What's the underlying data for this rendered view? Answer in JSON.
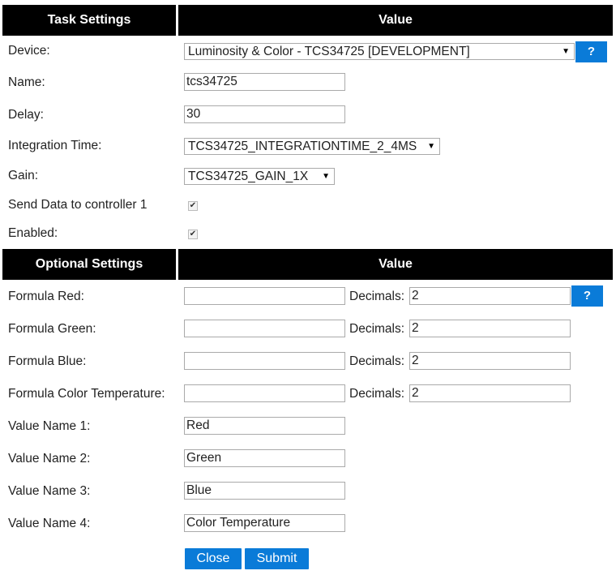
{
  "task_table": {
    "header_left": "Task Settings",
    "header_right": "Value",
    "rows": [
      {
        "label": "Device:",
        "value": "Luminosity & Color - TCS34725 [DEVELOPMENT]"
      },
      {
        "label": "Name:",
        "value": "tcs34725"
      },
      {
        "label": "Delay:",
        "value": "30"
      },
      {
        "label": "Integration Time:",
        "value": "TCS34725_INTEGRATIONTIME_2_4MS"
      },
      {
        "label": "Gain:",
        "value": "TCS34725_GAIN_1X"
      },
      {
        "label": "Send Data to controller 1",
        "checked": true
      },
      {
        "label": "Enabled:",
        "checked": true
      }
    ],
    "help_label": "?"
  },
  "optional_table": {
    "header_left": "Optional Settings",
    "header_right": "Value",
    "decimals_label": "Decimals:",
    "formulas": [
      {
        "label": "Formula Red:",
        "formula": "",
        "decimals": "2"
      },
      {
        "label": "Formula Green:",
        "formula": "",
        "decimals": "2"
      },
      {
        "label": "Formula Blue:",
        "formula": "",
        "decimals": "2"
      },
      {
        "label": "Formula Color Temperature:",
        "formula": "",
        "decimals": "2"
      }
    ],
    "value_names": [
      {
        "label": "Value Name 1:",
        "value": "Red"
      },
      {
        "label": "Value Name 2:",
        "value": "Green"
      },
      {
        "label": "Value Name 3:",
        "value": "Blue"
      },
      {
        "label": "Value Name 4:",
        "value": "Color Temperature"
      }
    ],
    "help_label": "?"
  },
  "actions": {
    "close_label": "Close",
    "submit_label": "Submit"
  },
  "colors": {
    "header_bg": "#000000",
    "button_bg": "#0a7bd8"
  }
}
